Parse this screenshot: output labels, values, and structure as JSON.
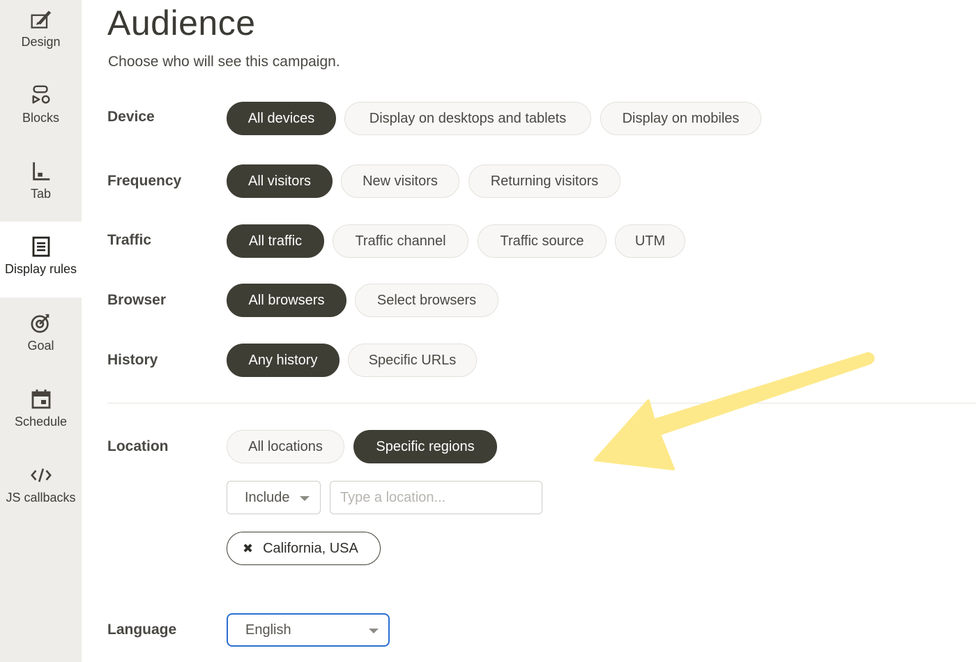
{
  "sidebar": {
    "items": [
      {
        "label": "Design",
        "icon": "design-icon"
      },
      {
        "label": "Blocks",
        "icon": "blocks-icon"
      },
      {
        "label": "Tab",
        "icon": "tab-icon"
      },
      {
        "label": "Display rules",
        "icon": "display-rules-icon",
        "active": true
      },
      {
        "label": "Goal",
        "icon": "goal-icon"
      },
      {
        "label": "Schedule",
        "icon": "calendar-icon"
      },
      {
        "label": "JS callbacks",
        "icon": "code-icon"
      }
    ]
  },
  "page": {
    "title": "Audience",
    "subtitle": "Choose who will see this campaign."
  },
  "rules": {
    "device": {
      "label": "Device",
      "options": [
        "All devices",
        "Display on desktops and tablets",
        "Display on mobiles"
      ],
      "selected": "All devices"
    },
    "frequency": {
      "label": "Frequency",
      "options": [
        "All visitors",
        "New visitors",
        "Returning visitors"
      ],
      "selected": "All visitors"
    },
    "traffic": {
      "label": "Traffic",
      "options": [
        "All traffic",
        "Traffic channel",
        "Traffic source",
        "UTM"
      ],
      "selected": "All traffic"
    },
    "browser": {
      "label": "Browser",
      "options": [
        "All browsers",
        "Select browsers"
      ],
      "selected": "All browsers"
    },
    "history": {
      "label": "History",
      "options": [
        "Any history",
        "Specific URLs"
      ],
      "selected": "Any history"
    },
    "location": {
      "label": "Location",
      "options": [
        "All locations",
        "Specific regions"
      ],
      "selected": "Specific regions",
      "mode": "Include",
      "placeholder": "Type a location...",
      "tags": [
        "California, USA"
      ]
    },
    "language": {
      "label": "Language",
      "value": "English"
    }
  },
  "colors": {
    "selected_pill": "#3f3e35",
    "sidebar_bg": "#eeede9",
    "focus_border": "#2b6fd2",
    "annotation_arrow": "#fde98a"
  }
}
